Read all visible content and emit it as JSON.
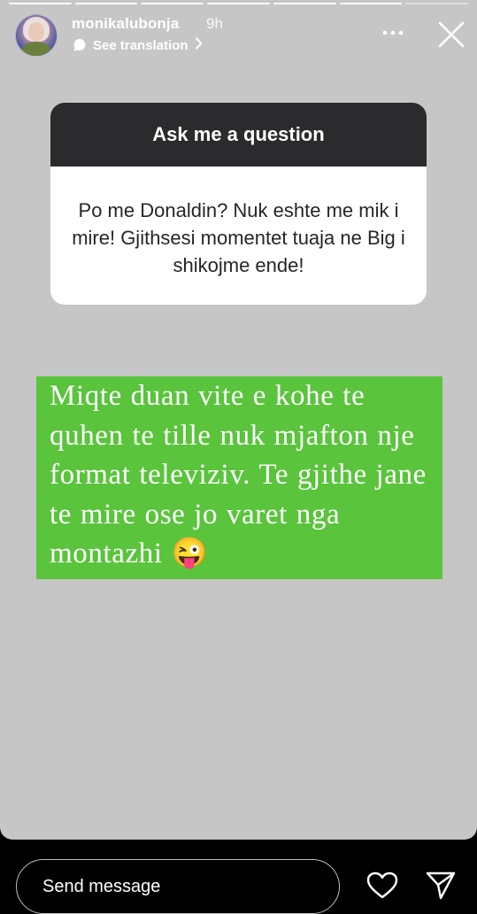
{
  "story": {
    "background_color": "#c6c6c6",
    "progress_segments": 7,
    "active_segment": 5
  },
  "header": {
    "username": "monikalubonja",
    "time": "9h",
    "translation_label": "See translation",
    "icons": [
      "more-icon",
      "close-icon",
      "chevron-right-icon",
      "speech-bubble-icon"
    ]
  },
  "question_sticker": {
    "title": "Ask me a question",
    "question": "Po me Donaldin? Nuk eshte me mik i mire! Gjithsesi momentet tuaja ne Big i shikojme ende!"
  },
  "answer": {
    "text": "Miqte duan vite e kohe te quhen te tille nuk mjafton nje format televiziv. Te gjithe jane te mire ose jo varet nga montazhi 😜",
    "background_color": "#5ac43c"
  },
  "footer": {
    "send_placeholder": "Send message",
    "icons": [
      "heart-icon",
      "direct-send-icon"
    ]
  }
}
